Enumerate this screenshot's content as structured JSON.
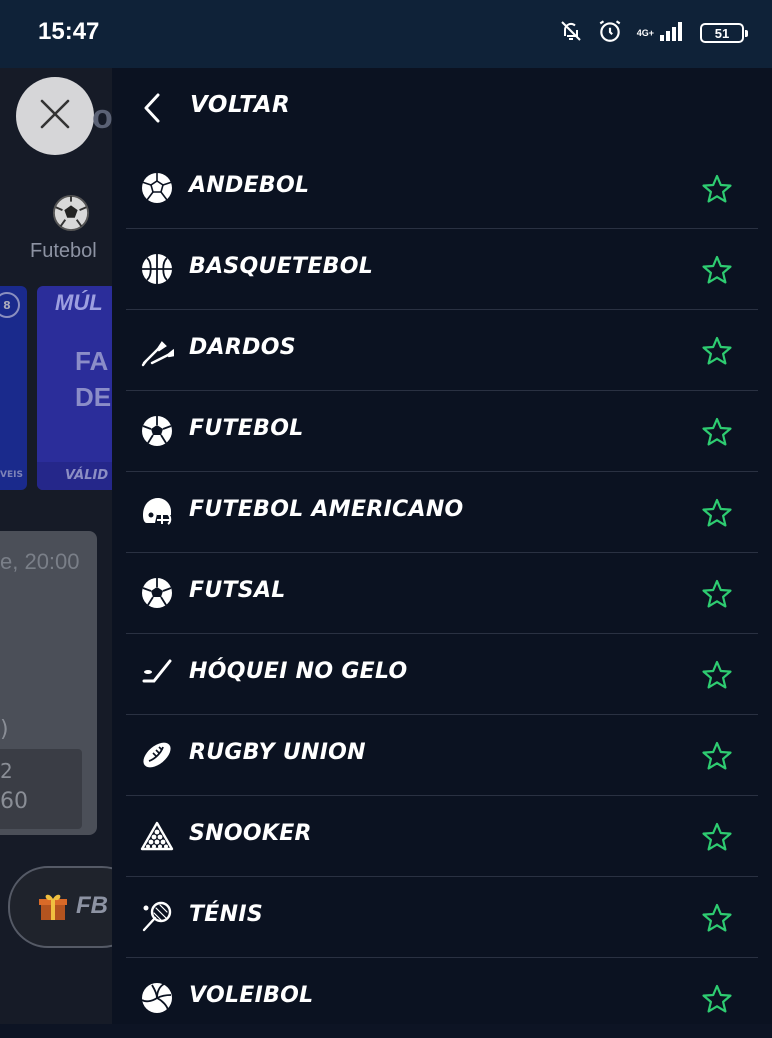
{
  "status_bar": {
    "time": "15:47",
    "network": "4G+",
    "battery": "51"
  },
  "background": {
    "tab_label": "Futebol",
    "card_left_badge": "8",
    "card_left_footer": "VEIS",
    "card_title": "MÚL",
    "card_line1": "FA",
    "card_line2": "DE",
    "card_footer": "VÁLID",
    "event_time": "e, 20:00",
    "event_paren": ")",
    "odd_label": "2",
    "odd_value": "60",
    "pill_label": "FB"
  },
  "panel": {
    "back_label": "VOLTAR",
    "accent_color": "#2ecc71",
    "sports": [
      {
        "label": "ANDEBOL",
        "icon": "handball-icon"
      },
      {
        "label": "BASQUETEBOL",
        "icon": "basketball-icon"
      },
      {
        "label": "DARDOS",
        "icon": "darts-icon"
      },
      {
        "label": "FUTEBOL",
        "icon": "soccer-ball-icon"
      },
      {
        "label": "FUTEBOL AMERICANO",
        "icon": "football-helmet-icon"
      },
      {
        "label": "FUTSAL",
        "icon": "futsal-ball-icon"
      },
      {
        "label": "HÓQUEI NO GELO",
        "icon": "hockey-stick-icon"
      },
      {
        "label": "RUGBY UNION",
        "icon": "rugby-ball-icon"
      },
      {
        "label": "SNOOKER",
        "icon": "snooker-triangle-icon"
      },
      {
        "label": "TÉNIS",
        "icon": "tennis-racket-icon"
      },
      {
        "label": "VOLEIBOL",
        "icon": "volleyball-icon"
      }
    ]
  }
}
